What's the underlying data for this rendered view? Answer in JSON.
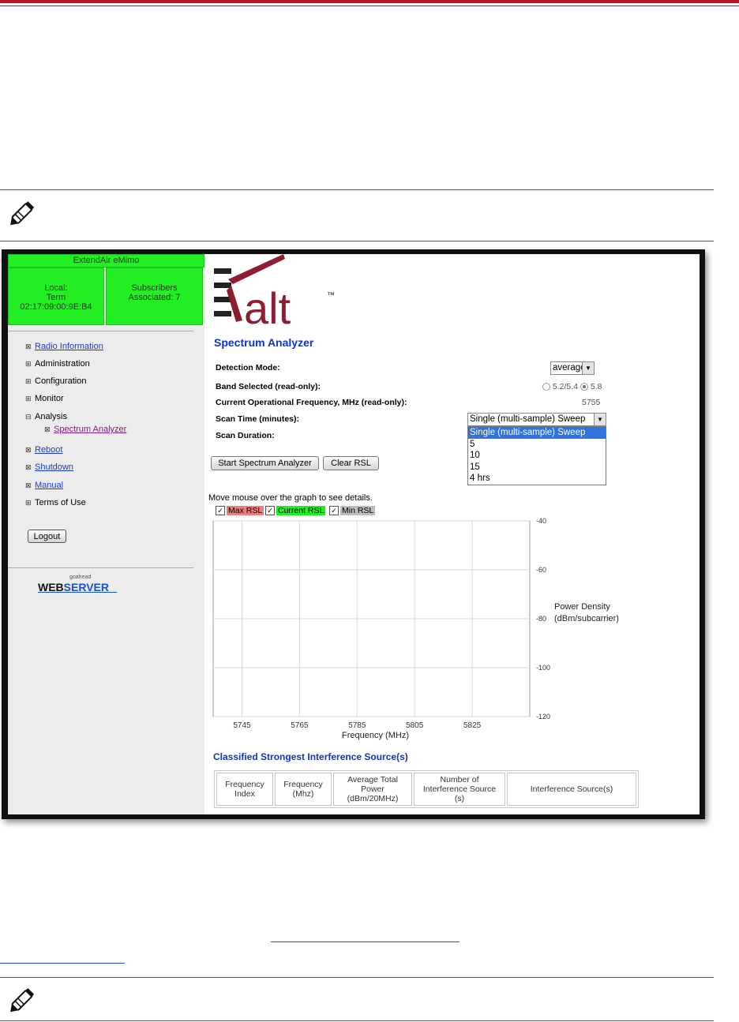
{
  "sidebar": {
    "product": "ExtendAir eMimo",
    "local": [
      "Local:",
      "Term",
      "02:17:09:00:9E:B4"
    ],
    "subscribers": [
      "Subscribers",
      "Associated: 7"
    ],
    "nav": [
      {
        "icon": "⊠",
        "label": "Radio Information",
        "link": true,
        "visited": false
      },
      {
        "icon": "⊞",
        "label": "Administration",
        "link": false
      },
      {
        "icon": "⊞",
        "label": "Configuration",
        "link": false
      },
      {
        "icon": "⊞",
        "label": "Monitor",
        "link": false
      },
      {
        "icon": "⊟",
        "label": "Analysis",
        "link": false
      },
      {
        "icon": "⊠",
        "label": "Spectrum Analyzer",
        "link": true,
        "visited": true,
        "sub": true
      },
      {
        "icon": "⊠",
        "label": "Reboot",
        "link": true,
        "visited": false
      },
      {
        "icon": "⊠",
        "label": "Shutdown",
        "link": true,
        "visited": false
      },
      {
        "icon": "⊠",
        "label": "Manual",
        "link": true,
        "visited": false
      },
      {
        "icon": "⊞",
        "label": "Terms of Use",
        "link": false
      }
    ],
    "logout": "Logout",
    "webserver_small": "goahead",
    "webserver_web": "WEB",
    "webserver_server": "SERVER"
  },
  "main": {
    "logo_text": "alt",
    "logo_tm": "™",
    "title": "Spectrum Analyzer",
    "fields": {
      "detection_mode": "Detection Mode:",
      "band_selected": "Band Selected (read-only):",
      "current_freq": "Current Operational Frequency, MHz (read-only):",
      "scan_time": "Scan Time (minutes):",
      "scan_duration": "Scan Duration:"
    },
    "detection_value": "average",
    "band_options": [
      "5.2/5.4",
      "5.8"
    ],
    "current_freq_value": "5755",
    "scan_time_value": "Single (multi-sample) Sweep",
    "scan_time_options": [
      "Single (multi-sample) Sweep",
      "5",
      "10",
      "15",
      "4 hrs"
    ],
    "start_button": "Start Spectrum Analyzer",
    "clear_button": "Clear RSL",
    "hint": "Move mouse over the graph to see details.",
    "legend": [
      {
        "label": "Max RSL",
        "color": "#f07d7d"
      },
      {
        "label": "Current RSL",
        "color": "#22ee22"
      },
      {
        "label": "Min RSL",
        "color": "#bdbdbd"
      }
    ],
    "interference_title": "Classified Strongest Interference Source(s)",
    "table_headers": [
      [
        "Frequency",
        "Index"
      ],
      [
        "Frequency",
        "(Mhz)"
      ],
      [
        "Average Total",
        "Power",
        "(dBm/20MHz)"
      ],
      [
        "Number of",
        "Interference Source",
        "(s)"
      ],
      [
        "Interference Source(s)"
      ]
    ]
  },
  "chart_data": {
    "type": "line",
    "xlabel": "Frequency (MHz)",
    "ylabel": "Power Density (dBm/subcarrier)",
    "ylabel_lines": [
      "Power Density",
      "(dBm/subcarrier)"
    ],
    "x_ticks": [
      5745,
      5765,
      5785,
      5805,
      5825
    ],
    "xlim": [
      5735,
      5845
    ],
    "y_ticks": [
      -40,
      -60,
      -80,
      -100,
      -120
    ],
    "ylim": [
      -120,
      -40
    ],
    "series": [],
    "grid": true
  },
  "colors": {
    "accent_red": "#c1121f",
    "status_green": "#22ee22",
    "title_blue": "#1033c8",
    "logo_maroon": "#8f1d31",
    "dropdown_highlight": "#2f72e0"
  }
}
